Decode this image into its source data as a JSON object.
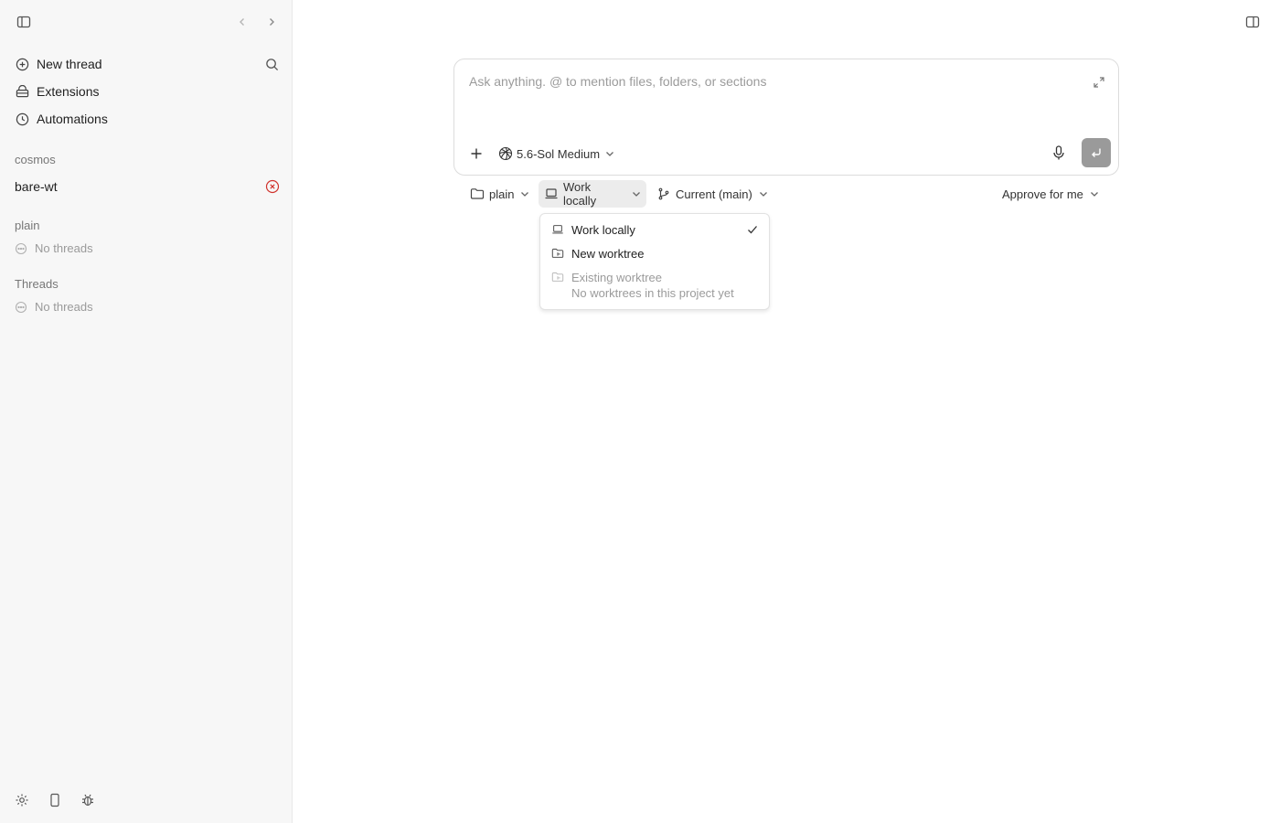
{
  "sidebar": {
    "toggle_icon": "sidebar-icon",
    "back_icon": "chevron-left-icon",
    "forward_icon": "chevron-right-icon",
    "nav": [
      {
        "label": "New thread",
        "icon": "plus-circle-icon"
      },
      {
        "label": "Extensions",
        "icon": "extensions-icon"
      },
      {
        "label": "Automations",
        "icon": "clock-icon"
      }
    ],
    "search_icon": "search-icon",
    "org_label": "cosmos",
    "project_name": "bare-wt",
    "project_status_icon": "error-circle-icon",
    "groups": [
      {
        "label": "plain",
        "empty_text": "No threads"
      },
      {
        "label": "Threads",
        "empty_text": "No threads"
      }
    ],
    "footer_icons": [
      "settings-icon",
      "phone-icon",
      "bug-icon"
    ]
  },
  "composer": {
    "placeholder": "Ask anything. @ to mention files, folders, or sections",
    "model_label": "5.6-Sol Medium",
    "accent_send": "#9a9a9a"
  },
  "toolbar": {
    "folder_label": "plain",
    "location_label": "Work locally",
    "branch_label": "Current (main)",
    "approval_label": "Approve for me"
  },
  "location_menu": {
    "items": [
      {
        "label": "Work locally",
        "selected": true,
        "icon": "laptop-icon"
      },
      {
        "label": "New worktree",
        "selected": false,
        "icon": "worktree-icon"
      },
      {
        "label": "Existing worktree",
        "selected": false,
        "disabled": true,
        "icon": "worktree-icon"
      }
    ],
    "existing_hint": "No worktrees in this project yet"
  }
}
